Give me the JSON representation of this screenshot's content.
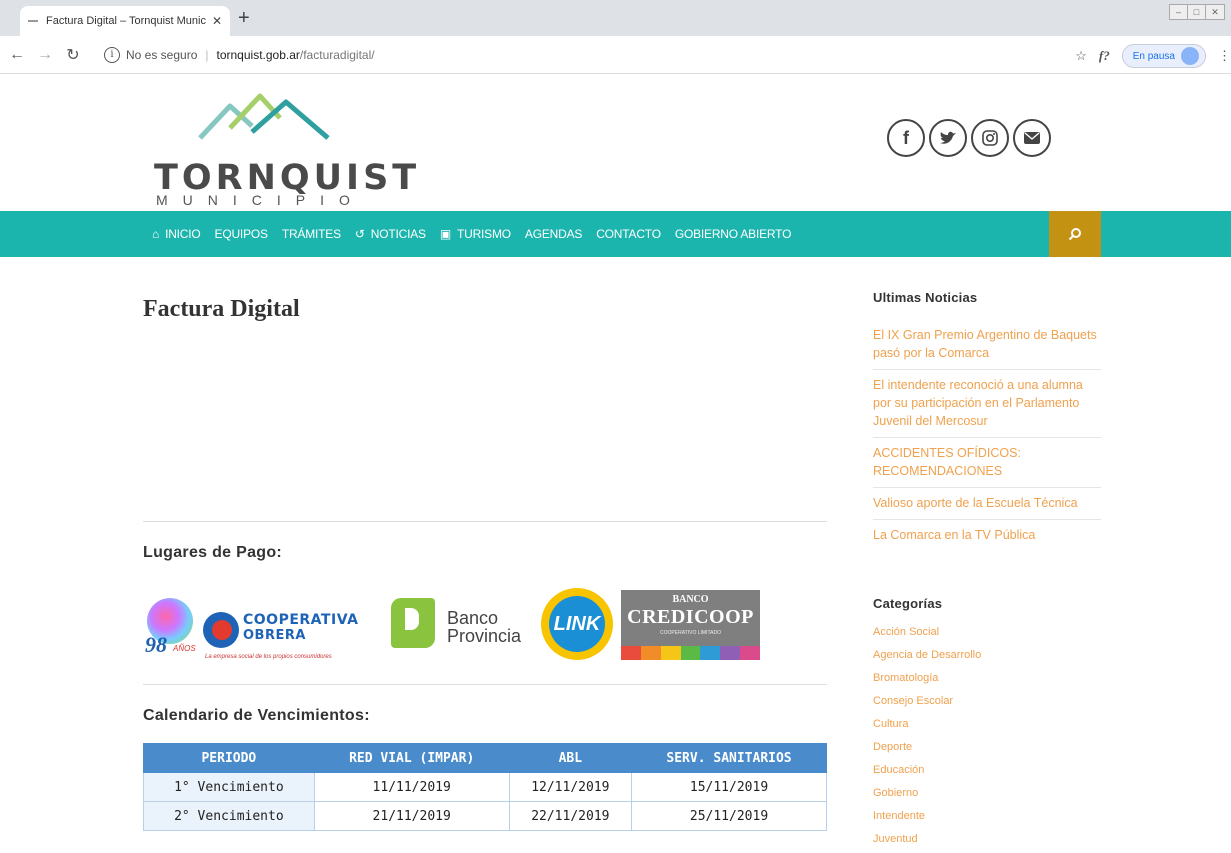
{
  "browser": {
    "tab_title": "Factura Digital – Tornquist Municipio",
    "tab_close": "✕",
    "new_tab": "+",
    "security": "No es seguro",
    "url_host": "tornquist.gob.ar",
    "url_path": "/facturadigital/",
    "bookmark_icon": "☆",
    "ext_label": "f?",
    "pausa_label": "En pausa",
    "menu_icon": "⋮"
  },
  "site": {
    "logo_word": "TORNQUIST",
    "logo_sub": "MUNICIPIO",
    "social": [
      "f",
      "t",
      "i",
      "✉"
    ]
  },
  "nav": {
    "items": [
      {
        "label": "INICIO",
        "icon": "home-icon"
      },
      {
        "label": "EQUIPOS"
      },
      {
        "label": "TRÁMITES"
      },
      {
        "label": "NOTICIAS",
        "icon": "history-icon"
      },
      {
        "label": "TURISMO",
        "icon": "image-icon"
      },
      {
        "label": "AGENDAS"
      },
      {
        "label": "CONTACTO"
      },
      {
        "label": "GOBIERNO ABIERTO"
      }
    ],
    "search_icon": "⌕"
  },
  "main": {
    "title": "Factura Digital",
    "lugares_heading": "Lugares de Pago:",
    "logos": {
      "coop_years": "98",
      "coop_anos": "AÑOS",
      "coop_line1": "COOPERATIVA",
      "coop_line2": "OBRERA",
      "coop_tagline": "La empresa social de los propios consumidores",
      "bprov_line1": "Banco",
      "bprov_line2": "Provincia",
      "link_text": "LINK",
      "credi_top": "BANCO",
      "credi_main": "CREDICOOP",
      "credi_sub": "COOPERATIVO LIMITADO"
    },
    "calendar_heading": "Calendario de Vencimientos:",
    "table": {
      "headers": [
        "PERIODO",
        "RED VIAL (IMPAR)",
        "ABL",
        "SERV. SANITARIOS"
      ],
      "rows": [
        [
          "1° Vencimiento",
          "11/11/2019",
          "12/11/2019",
          "15/11/2019"
        ],
        [
          "2° Vencimiento",
          "21/11/2019",
          "22/11/2019",
          "25/11/2019"
        ]
      ]
    }
  },
  "sidebar": {
    "news_heading": "Ultimas Noticias",
    "news": [
      "El IX Gran Premio Argentino de Baquets pasó por la Comarca",
      "El intendente reconoció a una alumna por su participación en el Parlamento Juvenil del Mercosur",
      "ACCIDENTES OFÍDICOS: RECOMENDACIONES",
      "Valioso aporte de la Escuela Técnica",
      "La Comarca en la TV Pública"
    ],
    "categories_heading": "Categorías",
    "categories": [
      "Acción Social",
      "Agencia de Desarrollo",
      "Bromatología",
      "Consejo Escolar",
      "Cultura",
      "Deporte",
      "Educación",
      "Gobierno",
      "Intendente",
      "Juventud"
    ]
  }
}
